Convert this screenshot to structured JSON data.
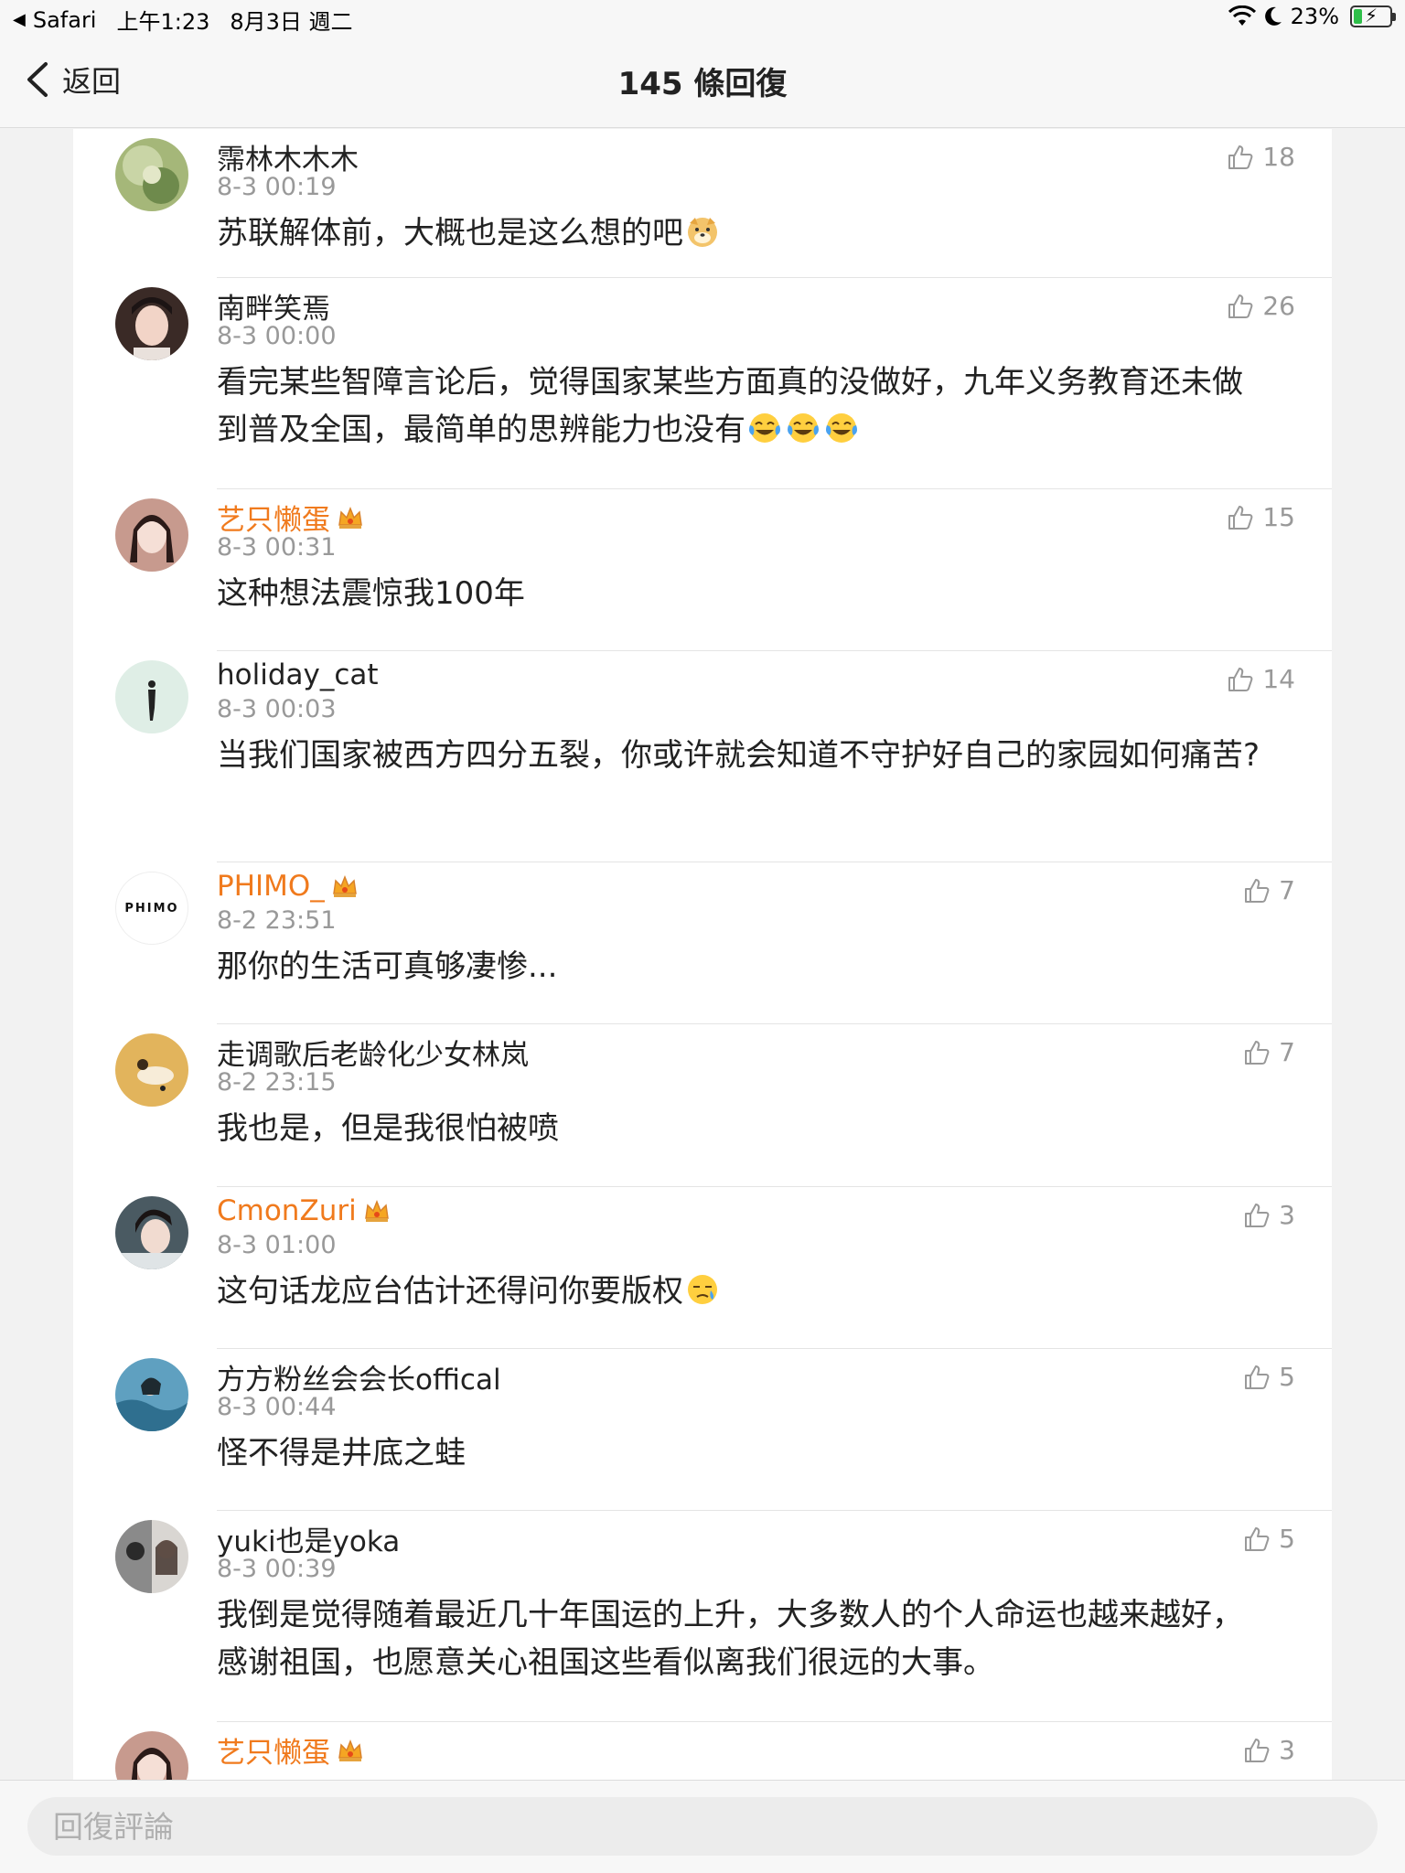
{
  "status_bar": {
    "app": "Safari",
    "time": "上午1:23",
    "date": "8月3日 週二",
    "battery": "23%",
    "battery_level": 0.23
  },
  "nav": {
    "back_label": "返回",
    "title": "145 條回復"
  },
  "comments": [
    {
      "username": "霈林木木木",
      "vip": false,
      "time": "8-3 00:19",
      "likes": "18",
      "text": "苏联解体前，大概也是这么想的吧",
      "emoji": "doge-emoji"
    },
    {
      "username": "南畔笑焉",
      "vip": false,
      "time": "8-3 00:00",
      "likes": "26",
      "text": "看完某些智障言论后，觉得国家某些方面真的没做好，九年义务教育还未做到普及全国，最简单的思辨能力也没有",
      "emoji": "laugh-cry-emoji x3"
    },
    {
      "username": "艺只懒蛋",
      "vip": true,
      "time": "8-3 00:31",
      "likes": "15",
      "text": "这种想法震惊我100年"
    },
    {
      "username": "holiday_cat",
      "vip": false,
      "time": "8-3 00:03",
      "likes": "14",
      "text": "当我们国家被西方四分五裂，你或许就会知道不守护好自己的家园如何痛苦?"
    },
    {
      "username": "PHIMO_",
      "vip": true,
      "time": "8-2 23:51",
      "likes": "7",
      "text": "那你的生活可真够凄惨...",
      "avatar_text": "PHIMO"
    },
    {
      "username": "走调歌后老龄化少女林岚",
      "vip": false,
      "time": "8-2 23:15",
      "likes": "7",
      "text": "我也是，但是我很怕被喷"
    },
    {
      "username": "CmonZuri",
      "vip": true,
      "time": "8-3 01:00",
      "likes": "3",
      "text": "这句话龙应台估计还得问你要版权",
      "emoji": "sweat-emoji"
    },
    {
      "username": "方方粉丝会会长offical",
      "vip": false,
      "time": "8-3 00:44",
      "likes": "5",
      "text": "怪不得是井底之蛙"
    },
    {
      "username": "yuki也是yoka",
      "vip": false,
      "time": "8-3 00:39",
      "likes": "5",
      "text": "我倒是觉得随着最近几十年国运的上升，大多数人的个人命运也越来越好，感谢祖国，也愿意关心祖国这些看似离我们很远的大事。"
    },
    {
      "username": "艺只懒蛋",
      "vip": true,
      "likes": "3"
    }
  ],
  "reply": {
    "placeholder": "回復評論"
  },
  "colors": {
    "vip_name": "#f07a1d",
    "meta_gray": "#999999",
    "page_bg": "#f2f2f2",
    "panel_bg": "#ffffff"
  }
}
